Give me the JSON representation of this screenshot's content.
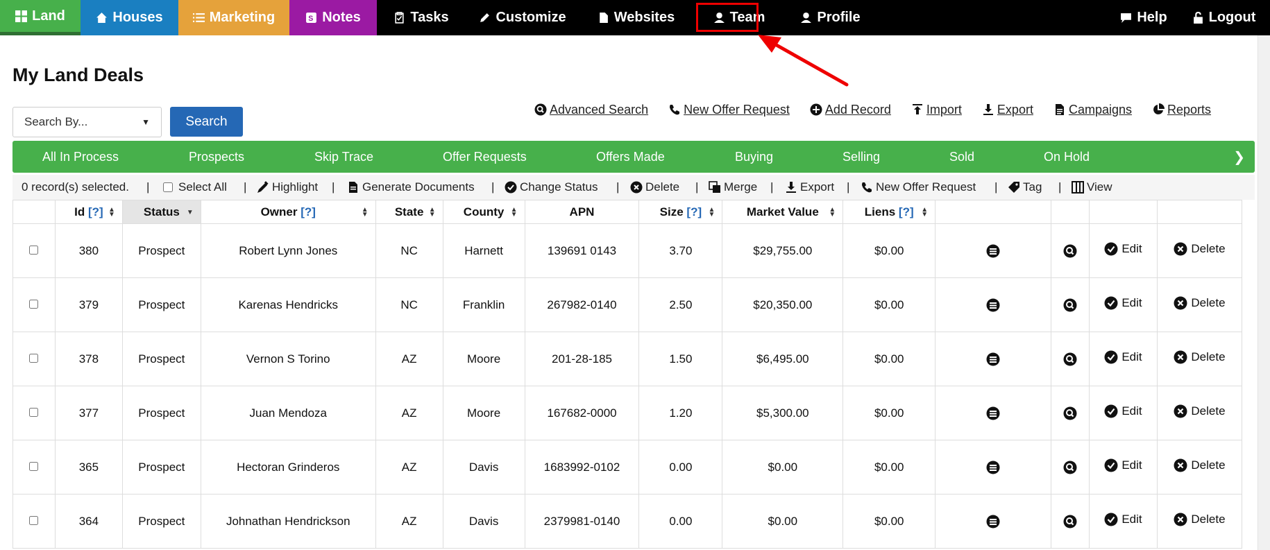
{
  "nav": {
    "land": "Land",
    "houses": "Houses",
    "marketing": "Marketing",
    "notes": "Notes",
    "tasks": "Tasks",
    "customize": "Customize",
    "websites": "Websites",
    "team": "Team",
    "profile": "Profile",
    "help": "Help",
    "logout": "Logout"
  },
  "colors": {
    "land_tab": "#47b04b",
    "houses_tab": "#1a7fc1",
    "marketing_tab": "#e5a23b",
    "notes_tab": "#9b1aa3",
    "status_bar": "#47b04b",
    "primary_button": "#2568b5",
    "highlight_box": "#ee0000"
  },
  "page_title": "My Land Deals",
  "search": {
    "select_value": "Search By...",
    "button_label": "Search"
  },
  "actions": {
    "advanced_search": "Advanced Search",
    "new_offer_request": "New Offer Request",
    "add_record": "Add Record",
    "import": "Import",
    "export": "Export",
    "campaigns": "Campaigns",
    "reports": "Reports"
  },
  "status_tabs": [
    "All In Process",
    "Prospects",
    "Skip Trace",
    "Offer Requests",
    "Offers Made",
    "Buying",
    "Selling",
    "Sold",
    "On Hold"
  ],
  "status_next": "❯",
  "bulk": {
    "selected_text": "0 record(s) selected.",
    "select_all": "Select All",
    "highlight": "Highlight",
    "generate_documents": "Generate Documents",
    "change_status": "Change Status",
    "delete": "Delete",
    "merge": "Merge",
    "export": "Export",
    "new_offer_request": "New Offer Request",
    "tag": "Tag",
    "view": "View",
    "separator": "|"
  },
  "table": {
    "headers": {
      "id": "Id",
      "status": "Status",
      "owner": "Owner",
      "state": "State",
      "county": "County",
      "apn": "APN",
      "size": "Size",
      "market_value": "Market Value",
      "liens": "Liens",
      "hint": "[?]"
    },
    "edit_label": "Edit",
    "delete_label": "Delete",
    "rows": [
      {
        "id": "380",
        "status": "Prospect",
        "owner": "Robert Lynn Jones",
        "state": "NC",
        "county": "Harnett",
        "apn": "139691 0143",
        "size": "3.70",
        "market_value": "$29,755.00",
        "liens": "$0.00"
      },
      {
        "id": "379",
        "status": "Prospect",
        "owner": "Karenas Hendricks",
        "state": "NC",
        "county": "Franklin",
        "apn": "267982-0140",
        "size": "2.50",
        "market_value": "$20,350.00",
        "liens": "$0.00"
      },
      {
        "id": "378",
        "status": "Prospect",
        "owner": "Vernon S Torino",
        "state": "AZ",
        "county": "Moore",
        "apn": "201-28-185",
        "size": "1.50",
        "market_value": "$6,495.00",
        "liens": "$0.00"
      },
      {
        "id": "377",
        "status": "Prospect",
        "owner": "Juan Mendoza",
        "state": "AZ",
        "county": "Moore",
        "apn": "167682-0000",
        "size": "1.20",
        "market_value": "$5,300.00",
        "liens": "$0.00"
      },
      {
        "id": "365",
        "status": "Prospect",
        "owner": "Hectoran Grinderos",
        "state": "AZ",
        "county": "Davis",
        "apn": "1683992-0102",
        "size": "0.00",
        "market_value": "$0.00",
        "liens": "$0.00"
      },
      {
        "id": "364",
        "status": "Prospect",
        "owner": "Johnathan Hendrickson",
        "state": "AZ",
        "county": "Davis",
        "apn": "2379981-0140",
        "size": "0.00",
        "market_value": "$0.00",
        "liens": "$0.00"
      }
    ]
  }
}
